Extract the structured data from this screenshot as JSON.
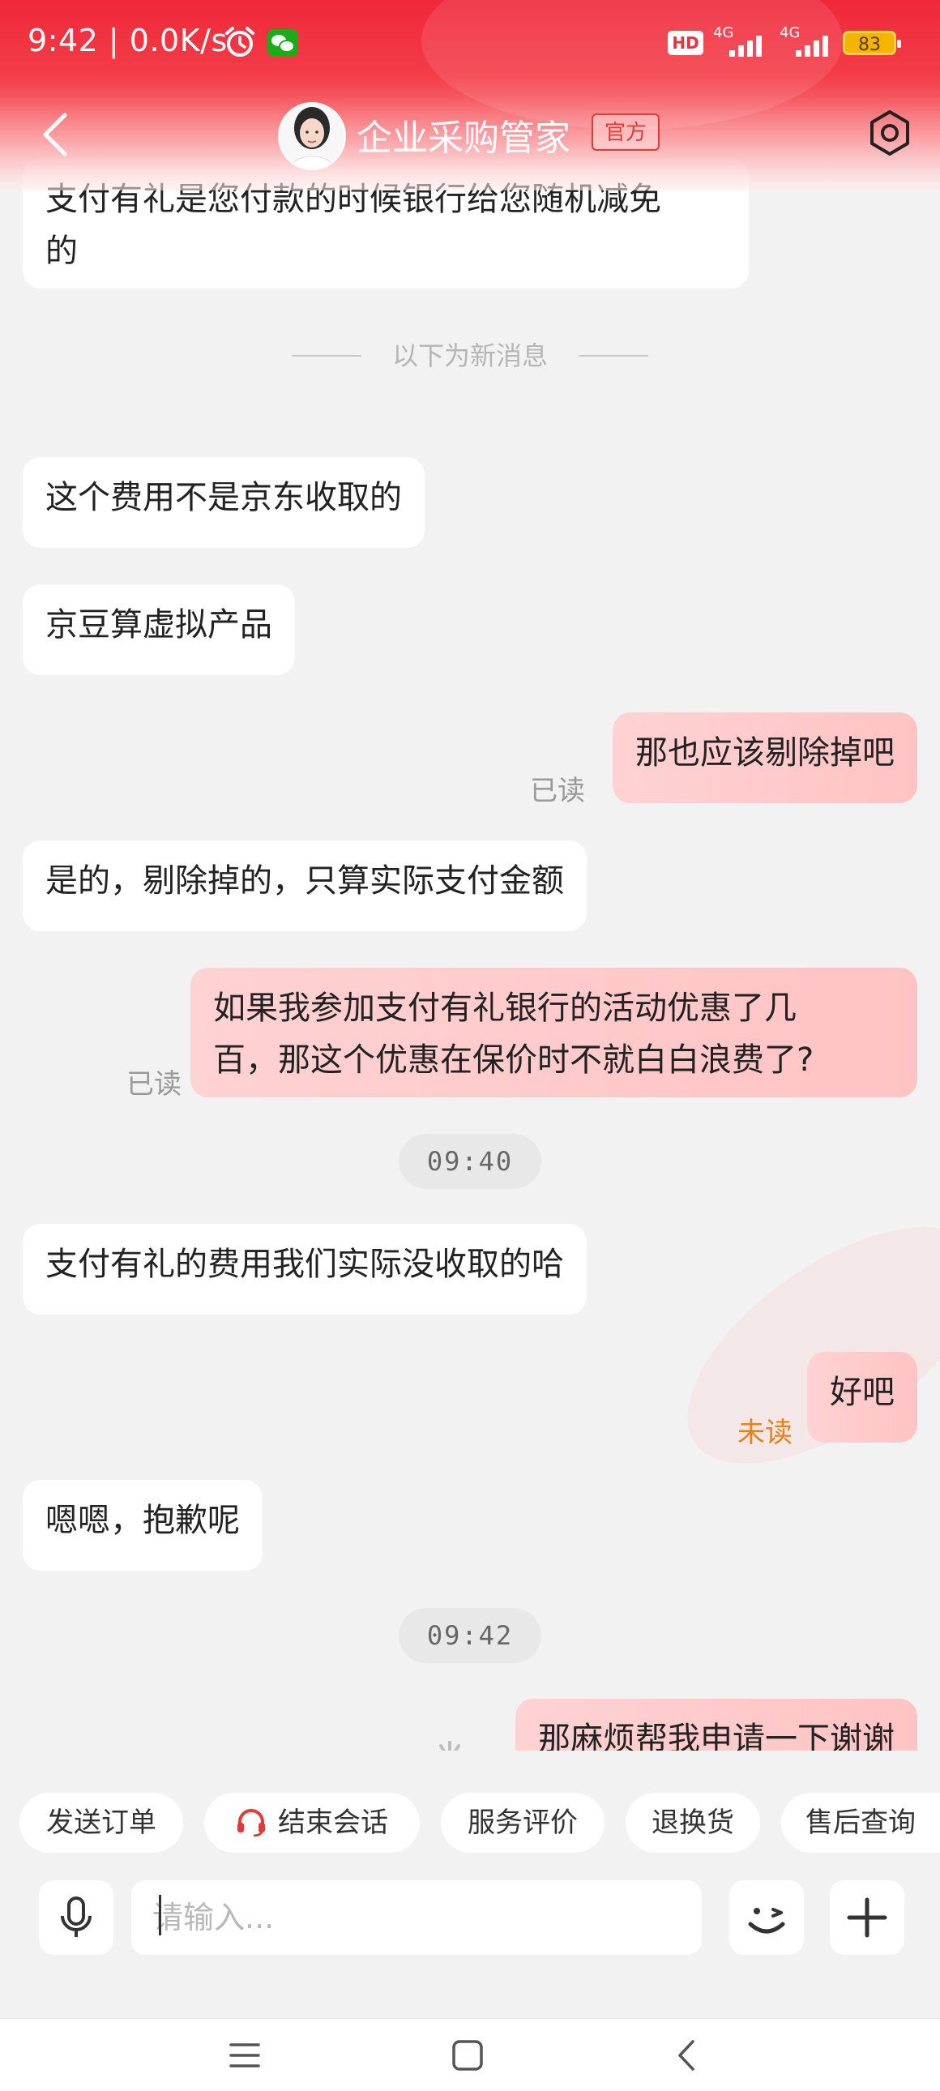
{
  "status_bar": {
    "time": "9:42 | 0.0K/s",
    "hd": "HD",
    "network_1": "4G",
    "network_2": "4G",
    "battery": "83"
  },
  "header": {
    "title": "企业采购管家",
    "badge": "官方"
  },
  "messages": {
    "m0_line1": "支付有礼是您付款的时候银行给您随机减免",
    "m0_line2": "的",
    "divider": "以下为新消息",
    "m1": "这个费用不是京东收取的",
    "m2": "京豆算虚拟产品",
    "m3": "那也应该剔除掉吧",
    "m3_status": "已读",
    "m4": "是的，剔除掉的，只算实际支付金额",
    "m5_line1": "如果我参加支付有礼银行的活动优惠了几",
    "m5_line2": "百，那这个优惠在保价时不就白白浪费了?",
    "m5_status": "已读",
    "time1": "09:40",
    "m6": "支付有礼的费用我们实际没收取的哈",
    "m7": "好吧",
    "m7_status": "未读",
    "m8": "嗯嗯，抱歉呢",
    "time2": "09:42",
    "m9": "那麻烦帮我申请一下谢谢"
  },
  "quick_actions": [
    "发送订单",
    "结束会话",
    "服务评价",
    "退换货",
    "售后查询"
  ],
  "input": {
    "placeholder": "请输入..."
  },
  "colors": {
    "header_red": "#f0283a",
    "outgoing_bubble": "#ffc8c9",
    "unread": "#e8801a",
    "badge": "#e53935"
  }
}
